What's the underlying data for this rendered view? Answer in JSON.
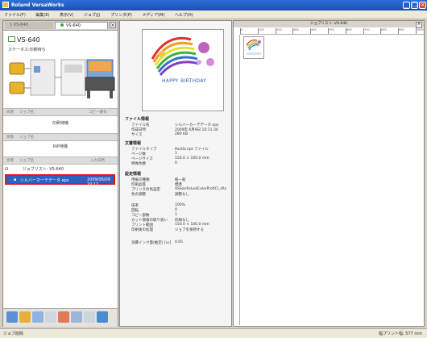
{
  "window": {
    "title": "Roland VersaWorks",
    "min": "_",
    "max": "□",
    "close": "×"
  },
  "menu": [
    "ファイル(F)",
    "編集(E)",
    "表示(V)",
    "ジョブ(J)",
    "プリンタ(P)",
    "メディア(M)",
    "ヘルプ(H)"
  ],
  "left_panel": {
    "tab_inactive": "1 VS-640",
    "tab_active": "VS-640",
    "close": "×",
    "printer_name": "VS-640",
    "printer_status": "ステータス:印刷待ち",
    "print_header": {
      "col1": "状態",
      "col2": "ジョブ名",
      "col3": "コピー番号"
    },
    "print_status": "印刷待機",
    "rip_header": {
      "col1": "状態",
      "col2": "ジョブ名"
    },
    "rip_status": "RIP待機",
    "queue_header": {
      "col1": "状態",
      "col2": "ジョブ名",
      "col3": "入力日時"
    },
    "queue_group": "ジョブリスト: VS-640",
    "queue_row": {
      "name": "シルバーカーテデータ.eps",
      "date": "2009/06/09 10:11"
    }
  },
  "mid_panel": {
    "thumb_text": "HAPPY BIRTHDAY",
    "file_info_title": "ファイル情報",
    "file_info": [
      {
        "k": "ファイル名",
        "v": "シルバーカーテデータ.eps"
      },
      {
        "k": "作成日時",
        "v": "2009年 6月9日 10:11:34"
      },
      {
        "k": "サイズ",
        "v": "280 KB"
      }
    ],
    "doc_info_title": "文書情報",
    "doc_info": [
      {
        "k": "ファイルタイプ",
        "v": "PostScript ファイル"
      },
      {
        "k": "ページ数",
        "v": "1"
      },
      {
        "k": "ページサイズ",
        "v": "150.0 × 100.0 mm"
      },
      {
        "k": "特殊色数",
        "v": "0"
      }
    ],
    "settings_title": "設定情報",
    "settings": [
      {
        "k": "用紙の種類",
        "v": "紙ー般"
      },
      {
        "k": "印刷品質",
        "v": "標準"
      },
      {
        "k": "プリンタの色設定",
        "v": "VSSonRsLedColorProfiCl_sRs"
      },
      {
        "k": "色の調整",
        "v": "調整なし"
      },
      {
        "k": "倍率",
        "v": "100%"
      },
      {
        "k": "回転",
        "v": "0"
      },
      {
        "k": "コピー部数",
        "v": "1"
      },
      {
        "k": "カット情報の取り扱い",
        "v": "印刷なし"
      },
      {
        "k": "プリント範囲",
        "v": "150.0 × 100.0 mm"
      },
      {
        "k": "印刷後の処理",
        "v": "ジョブを保持する"
      }
    ],
    "ink_label": "消費インク量(推定) [cc]",
    "ink_value": "0.05"
  },
  "right_panel": {
    "title": "ジョブリスト: VS-640",
    "close": "×",
    "ruler_ticks": [
      "0",
      "100",
      "200",
      "300",
      "400",
      "500",
      "600",
      "700",
      "800",
      "900",
      "1000"
    ]
  },
  "status": {
    "left": "ジョブ削除",
    "right": "幅プリント幅: 577 mm"
  }
}
